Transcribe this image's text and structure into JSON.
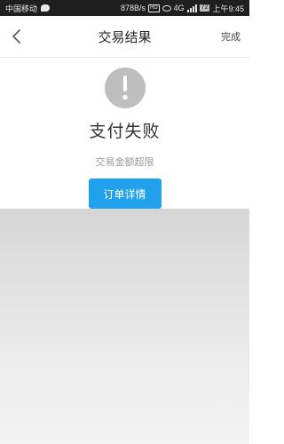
{
  "status_bar": {
    "carrier": "中国移动",
    "network_speed": "878B/s",
    "hd_label": "HD",
    "signal_label": "4G",
    "battery": "72",
    "time": "上午9:45"
  },
  "header": {
    "title": "交易结果",
    "done_label": "完成"
  },
  "result": {
    "title": "支付失败",
    "reason": "交易金额超限",
    "order_detail_label": "订单详情"
  },
  "colors": {
    "accent": "#21a0ec",
    "icon_gray": "#bebebe",
    "status_bar_bg": "#1f1f1f"
  },
  "icons": {
    "back": "chevron-left-icon",
    "alert": "exclamation-icon",
    "chat": "chat-bubble-icon",
    "eye": "eye-icon"
  }
}
